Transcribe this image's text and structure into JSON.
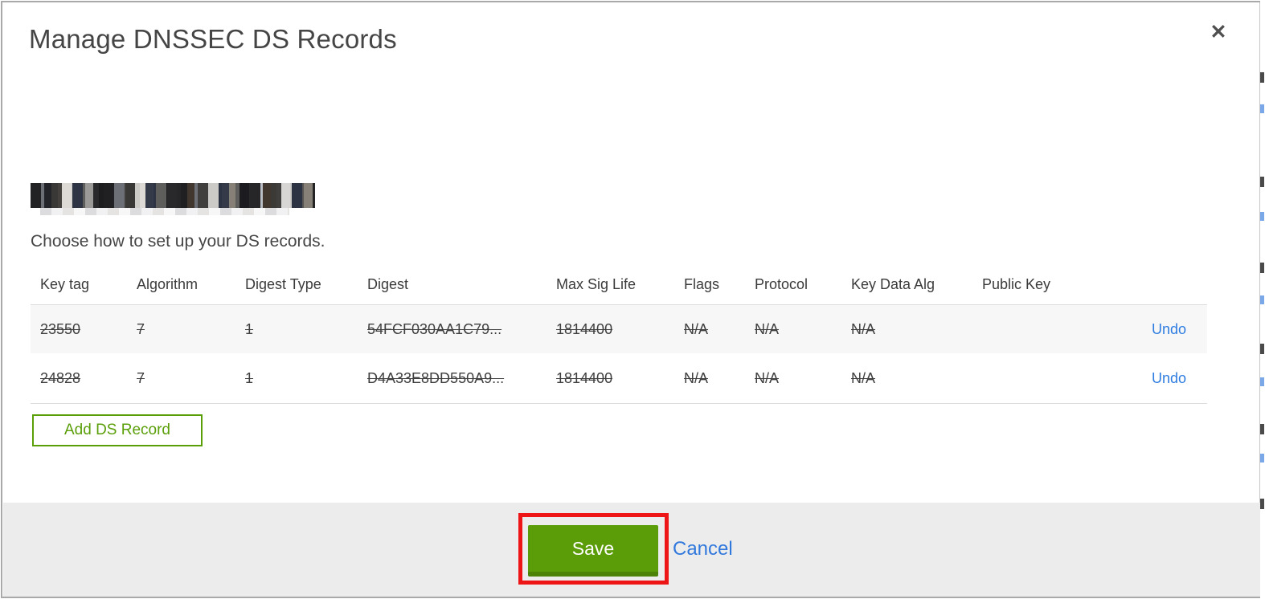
{
  "modal": {
    "title": "Manage DNSSEC DS Records",
    "close_glyph": "✕",
    "domain": {
      "redacted": true
    },
    "subtitle": "Choose how to set up your DS records.",
    "table": {
      "headers": [
        "Key tag",
        "Algorithm",
        "Digest Type",
        "Digest",
        "Max Sig Life",
        "Flags",
        "Protocol",
        "Key Data Alg",
        "Public Key"
      ],
      "rows": [
        {
          "key_tag": "23550",
          "algorithm": "7",
          "digest_type": "1",
          "digest": "54FCF030AA1C79...",
          "max_sig_life": "1814400",
          "flags": "N/A",
          "protocol": "N/A",
          "key_data_alg": "N/A",
          "public_key": "",
          "action": "Undo",
          "state": "marked-for-deletion"
        },
        {
          "key_tag": "24828",
          "algorithm": "7",
          "digest_type": "1",
          "digest": "D4A33E8DD550A9...",
          "max_sig_life": "1814400",
          "flags": "N/A",
          "protocol": "N/A",
          "key_data_alg": "N/A",
          "public_key": "",
          "action": "Undo",
          "state": "marked-for-deletion"
        }
      ]
    },
    "add_record_label": "Add DS Record",
    "footer": {
      "save_label": "Save",
      "cancel_label": "Cancel"
    }
  },
  "colors": {
    "accent_green": "#5b9c09",
    "accent_green_dark": "#4c8306",
    "outline_green": "#5a9e08",
    "link_blue": "#2f7de1",
    "annotation_red": "#ed1515",
    "footer_bg": "#ececec",
    "row_alt_bg": "#f7f7f7"
  }
}
